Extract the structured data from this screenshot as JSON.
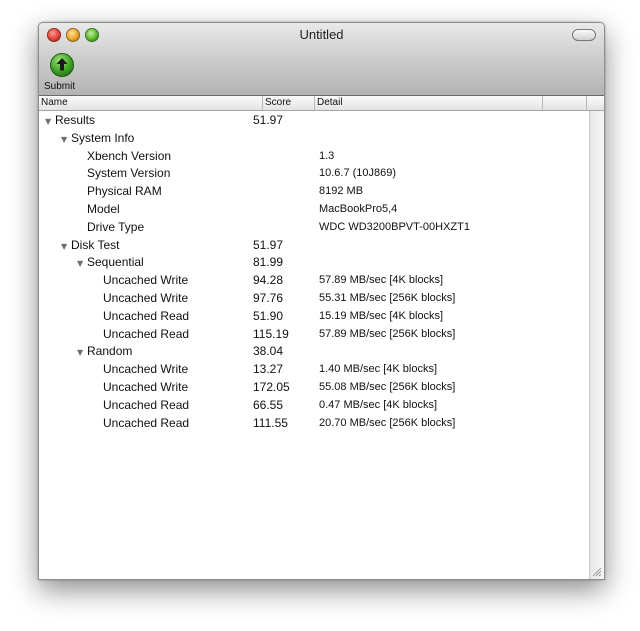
{
  "window": {
    "title": "Untitled"
  },
  "toolbar": {
    "submit_label": "Submit"
  },
  "columns": {
    "name": "Name",
    "score": "Score",
    "detail": "Detail"
  },
  "rows": [
    {
      "name": "Results",
      "score": "51.97",
      "detail": ""
    },
    {
      "name": "System Info",
      "score": "",
      "detail": ""
    },
    {
      "name": "Xbench Version",
      "score": "",
      "detail": "1.3"
    },
    {
      "name": "System Version",
      "score": "",
      "detail": "10.6.7 (10J869)"
    },
    {
      "name": "Physical RAM",
      "score": "",
      "detail": "8192 MB"
    },
    {
      "name": "Model",
      "score": "",
      "detail": "MacBookPro5,4"
    },
    {
      "name": "Drive Type",
      "score": "",
      "detail": "WDC WD3200BPVT-00HXZT1"
    },
    {
      "name": "Disk Test",
      "score": "51.97",
      "detail": ""
    },
    {
      "name": "Sequential",
      "score": "81.99",
      "detail": ""
    },
    {
      "name": "Uncached Write",
      "score": "94.28",
      "detail": "57.89 MB/sec [4K blocks]"
    },
    {
      "name": "Uncached Write",
      "score": "97.76",
      "detail": "55.31 MB/sec [256K blocks]"
    },
    {
      "name": "Uncached Read",
      "score": "51.90",
      "detail": "15.19 MB/sec [4K blocks]"
    },
    {
      "name": "Uncached Read",
      "score": "115.19",
      "detail": "57.89 MB/sec [256K blocks]"
    },
    {
      "name": "Random",
      "score": "38.04",
      "detail": ""
    },
    {
      "name": "Uncached Write",
      "score": "13.27",
      "detail": "1.40 MB/sec [4K blocks]"
    },
    {
      "name": "Uncached Write",
      "score": "172.05",
      "detail": "55.08 MB/sec [256K blocks]"
    },
    {
      "name": "Uncached Read",
      "score": "66.55",
      "detail": "0.47 MB/sec [4K blocks]"
    },
    {
      "name": "Uncached Read",
      "score": "111.55",
      "detail": "20.70 MB/sec [256K blocks]"
    }
  ],
  "icons": {
    "close": "close-icon",
    "minimize": "minimize-icon",
    "zoom": "zoom-icon",
    "submit": "upload-arrow-icon",
    "disclosure": "disclosure-triangle-icon",
    "resize": "resize-grip-icon"
  },
  "colors": {
    "close": "#e0443a",
    "minimize": "#e8a82c",
    "zoom": "#5cb82e",
    "submit": "#3aa022"
  }
}
